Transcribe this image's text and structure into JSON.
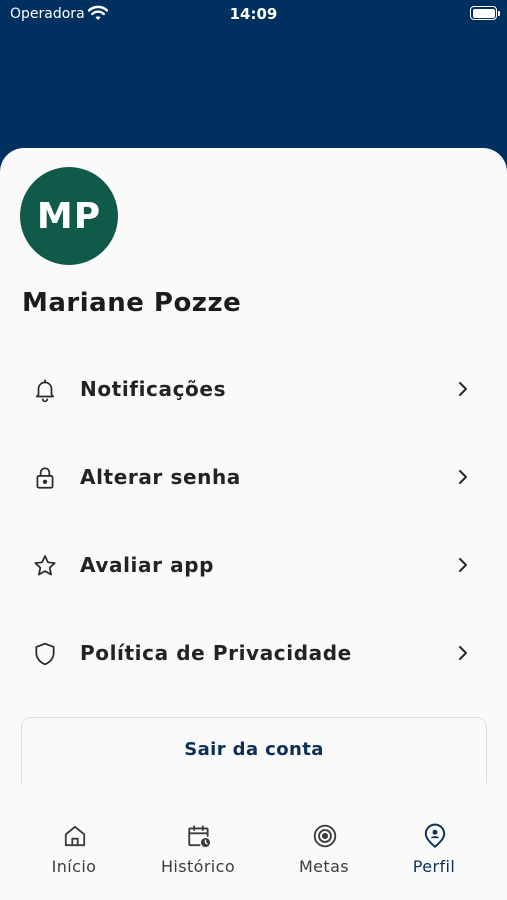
{
  "status_bar": {
    "carrier": "Operadora",
    "time": "14:09",
    "wifi_icon": "wifi-icon",
    "battery_icon": "battery-icon",
    "battery_level": 1.0
  },
  "profile": {
    "initials": "MP",
    "name": "Mariane Pozze",
    "avatar_color": "#0f5a48"
  },
  "menu": [
    {
      "label": "Notificações",
      "icon": "bell-icon"
    },
    {
      "label": "Alterar senha",
      "icon": "lock-icon"
    },
    {
      "label": "Avaliar app",
      "icon": "star-icon"
    },
    {
      "label": "Política de Privacidade",
      "icon": "shield-icon"
    }
  ],
  "logout_label": "Sair da conta",
  "bottom_nav": [
    {
      "label": "Início",
      "icon": "home-icon",
      "active": false
    },
    {
      "label": "Histórico",
      "icon": "calendar-clock-icon",
      "active": false
    },
    {
      "label": "Metas",
      "icon": "target-icon",
      "active": false
    },
    {
      "label": "Perfil",
      "icon": "profile-pin-icon",
      "active": true
    }
  ],
  "colors": {
    "header": "#003060",
    "accent": "#0c2f58",
    "background": "#fafafa"
  }
}
